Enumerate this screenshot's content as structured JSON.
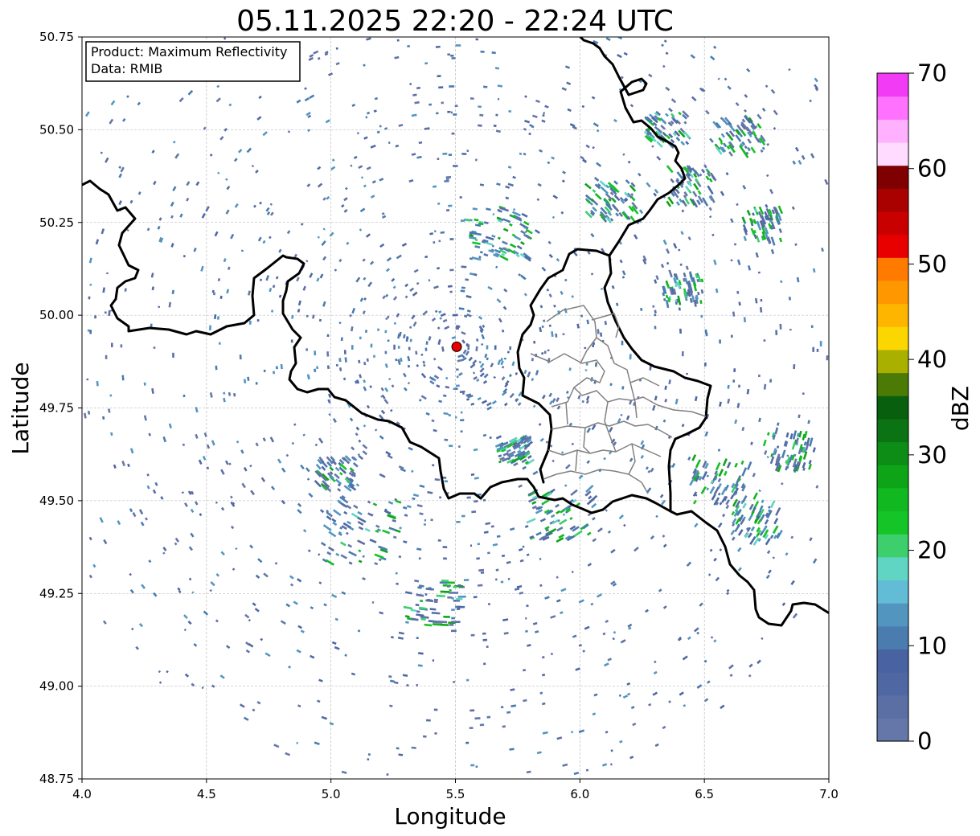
{
  "title": "05.11.2025 22:20 - 22:24 UTC",
  "info_box": {
    "product_line": "Product: Maximum Reflectivity",
    "data_line": "Data: RMIB"
  },
  "colorbar": {
    "label": "dBZ",
    "ticks": [
      "0",
      "10",
      "20",
      "30",
      "40",
      "50",
      "60",
      "70"
    ],
    "range": [
      0,
      70
    ],
    "colors": [
      "#6577a9",
      "#5b6fa4",
      "#4f68a4",
      "#4862a2",
      "#4a7cb0",
      "#5296c0",
      "#63bcd6",
      "#60d5c4",
      "#3ccf6c",
      "#15c426",
      "#12b81f",
      "#0ea417",
      "#0d8c16",
      "#0b7313",
      "#085f0d",
      "#4b7a05",
      "#aab000",
      "#fcd600",
      "#feb500",
      "#ff9800",
      "#ff7b00",
      "#e80000",
      "#c90000",
      "#a90000",
      "#7f0000",
      "#ffdbff",
      "#ffb1ff",
      "#ff72ff",
      "#f23bf5"
    ]
  },
  "map": {
    "xlabel": "Longitude",
    "ylabel": "Latitude",
    "xlim": [
      4.0,
      7.0
    ],
    "ylim": [
      48.75,
      50.75
    ],
    "xticks": [
      "4.0",
      "4.5",
      "5.0",
      "5.5",
      "6.0",
      "6.5",
      "7.0"
    ],
    "yticks": [
      "48.75",
      "49.00",
      "49.25",
      "49.50",
      "49.75",
      "50.00",
      "50.25",
      "50.50",
      "50.75"
    ],
    "grid": true,
    "radar_site": {
      "lon": 5.505,
      "lat": 49.915,
      "color": "#e60000"
    }
  }
}
